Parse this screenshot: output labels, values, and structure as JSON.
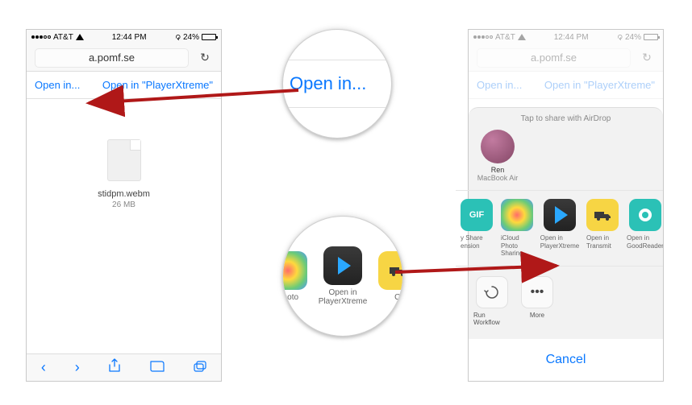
{
  "status": {
    "carrier": "AT&T",
    "time": "12:44 PM",
    "battery_pct": "24%"
  },
  "url": "a.pomf.se",
  "openbar": {
    "open_in": "Open in...",
    "open_in_app": "Open in \"PlayerXtreme\""
  },
  "file": {
    "name": "stidpm.webm",
    "size": "26 MB"
  },
  "mag1_text": "Open in...",
  "mag2": {
    "left_label": "Photo",
    "center_label": "Open in PlayerXtreme",
    "right_label": "O"
  },
  "sharesheet": {
    "caption": "Tap to share with AirDrop",
    "contact_name": "Ren",
    "contact_device": "MacBook Air",
    "apps": {
      "gif": "y Share ension",
      "photos": "iCloud Photo Sharing",
      "px": "Open in PlayerXtreme",
      "transmit": "Open in Transmit",
      "goodreader": "Open in GoodReader"
    },
    "actions": {
      "workflow": "Run Workflow",
      "more": "More"
    },
    "cancel": "Cancel"
  }
}
